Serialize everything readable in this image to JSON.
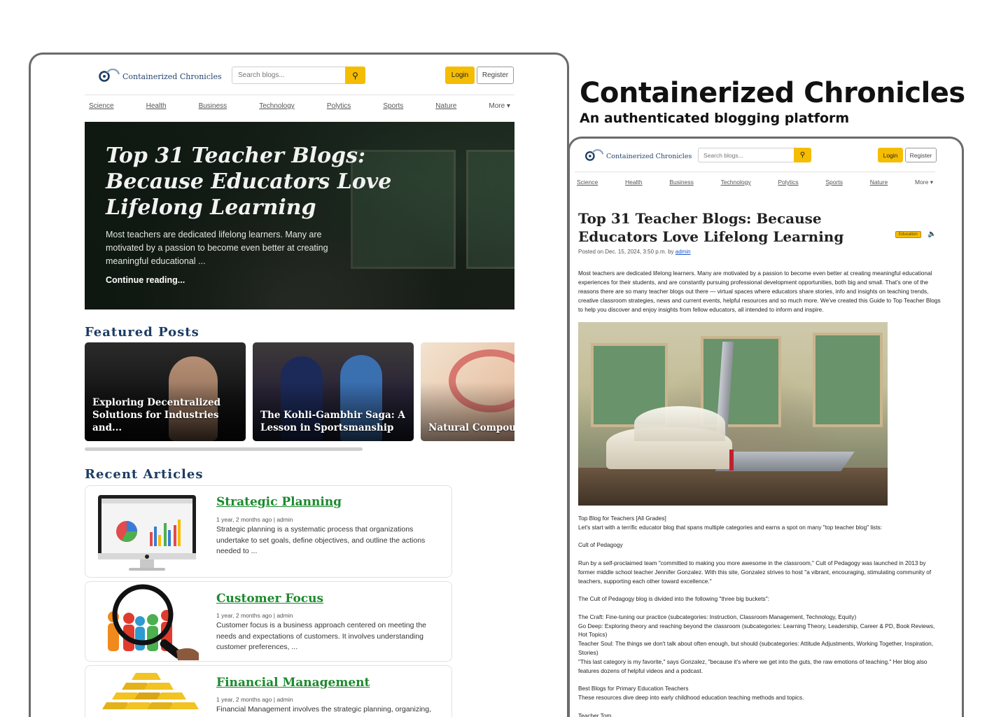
{
  "showcase": {
    "title": "Containerized Chronicles",
    "subtitle": "An authenticated blogging platform"
  },
  "site": {
    "brand": "Containerized Chronicles",
    "search_placeholder": "Search blogs...",
    "login_label": "Login",
    "register_label": "Register",
    "nav": [
      "Science",
      "Health",
      "Business",
      "Technology",
      "Polytics",
      "Sports",
      "Nature"
    ],
    "more_label": "More ▾"
  },
  "home": {
    "hero": {
      "title": "Top 31 Teacher Blogs: Because Educators Love Lifelong Learning",
      "excerpt": "Most teachers are dedicated lifelong learners. Many are motivated by a passion to become even better at creating meaningful educational ...",
      "link": "Continue reading..."
    },
    "featured_title": "Featured Posts",
    "featured": [
      {
        "title": "Exploring Decentralized Solutions for Industries and..."
      },
      {
        "title": "The Kohli-Gambhir Saga: A Lesson in Sportsmanship"
      },
      {
        "title": "Natural Compounds: Promise in Protect..."
      }
    ],
    "recent_title": "Recent Articles",
    "recent": [
      {
        "title": "Strategic Planning",
        "meta": "1 year, 2 months ago | admin",
        "excerpt": "Strategic planning is a systematic process that organizations undertake to set goals, define objectives, and outline the actions needed to ..."
      },
      {
        "title": "Customer Focus",
        "meta": "1 year, 2 months ago | admin",
        "excerpt": "Customer focus is a business approach centered on meeting the needs and expectations of customers. It involves understanding customer preferences, ..."
      },
      {
        "title": "Financial Management",
        "meta": "1 year, 2 months ago | admin",
        "excerpt": "Financial Management involves the strategic planning, organizing,"
      }
    ]
  },
  "article": {
    "title": "Top 31 Teacher Blogs: Because Educators Love Lifelong Learning",
    "badge": "Education",
    "meta_prefix": "Posted on Dec. 15, 2024, 3:50 p.m. by ",
    "author": "admin",
    "intro": "Most teachers are dedicated lifelong learners. Many are motivated by a passion to become even better at creating meaningful educational experiences for their students, and are constantly pursuing professional development opportunities, both big and small. That's one of the reasons there are so many teacher blogs out there — virtual spaces where educators share stories, info and insights on teaching trends, creative classroom strategies, news and current events, helpful resources and so much more. We've created this Guide to Top Teacher Blogs to help you discover and enjoy insights from fellow educators, all intended to inform and inspire.",
    "body": [
      "Top Blog for Teachers [All Grades]",
      "Let's start with a terrific educator blog that spans multiple categories and earns a spot on many \"top teacher blog\" lists:",
      "",
      "Cult of Pedagogy",
      "",
      "Run by a self-proclaimed team \"committed to making you more awesome in the classroom,\" Cult of Pedagogy was launched in 2013 by former middle school teacher Jennifer Gonzalez. With this site, Gonzalez strives to host \"a vibrant, encouraging, stimulating community of teachers, supporting each other toward excellence.\"",
      "",
      "The Cult of Pedagogy blog is divided into the following \"three big buckets\":",
      "",
      "The Craft: Fine-tuning our practice (subcategories: Instruction, Classroom Management, Technology, Equity)",
      "Go Deep: Exploring theory and reaching beyond the classroom (subcategories: Learning Theory, Leadership, Career & PD, Book Reviews, Hot Topics)",
      "Teacher Soul: The things we don't talk about often enough, but should (subcategories: Attitude Adjustments, Working Together, Inspiration, Stories)",
      "\"This last category is my favorite,\" says Gonzalez, \"because it's where we get into the guts, the raw emotions of teaching.\" Her blog also features dozens of helpful videos and a podcast.",
      "",
      "Best Blogs for Primary Education Teachers",
      "These resources dive deep into early childhood education teaching methods and topics.",
      "",
      "Teacher Tom"
    ]
  }
}
